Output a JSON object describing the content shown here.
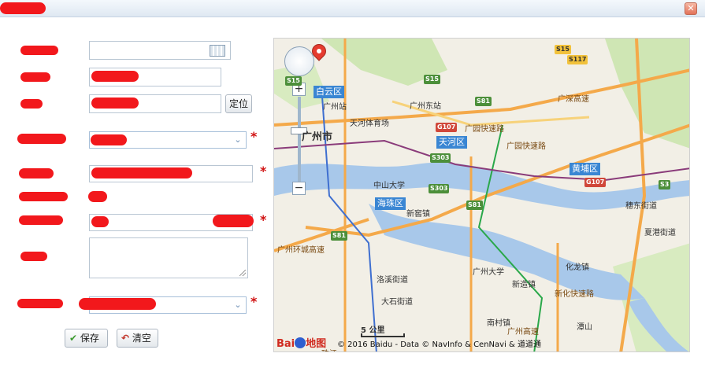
{
  "dialog": {
    "close_glyph": "✕"
  },
  "form": {
    "locate_button": "定位",
    "required_mark": "*",
    "save_button": "保存",
    "clear_button": "清空"
  },
  "map": {
    "districts": [
      "白云区",
      "天河区",
      "黄埔区",
      "海珠区"
    ],
    "city_label": "广州市",
    "poi": [
      "广州站",
      "广州东站",
      "天河体育场",
      "中山大学",
      "广州大学",
      "新窖镇",
      "洛溪街道",
      "大石街道",
      "新造镇",
      "化龙镇",
      "南村镇",
      "穗东街道",
      "夏港街道",
      "潭山"
    ],
    "roads": [
      "广深高速",
      "广园快速路",
      "广园快速路",
      "广州环城高速",
      "新化快速路",
      "广州高速",
      "珠江"
    ],
    "shields": [
      "S15",
      "S15",
      "S117",
      "S81",
      "S81",
      "S81",
      "S303",
      "S303",
      "G107",
      "G107",
      "S3",
      "S15"
    ],
    "scale_label": "5 公里",
    "copyright": "© 2016 Baidu - Data © NavInfo & CenNavi & 道道通",
    "logo_text": "Bai",
    "logo_text_2": "地图"
  },
  "colors": {
    "accent": "#3a86d3",
    "required": "#d01010",
    "redaction": "#f2181c"
  }
}
